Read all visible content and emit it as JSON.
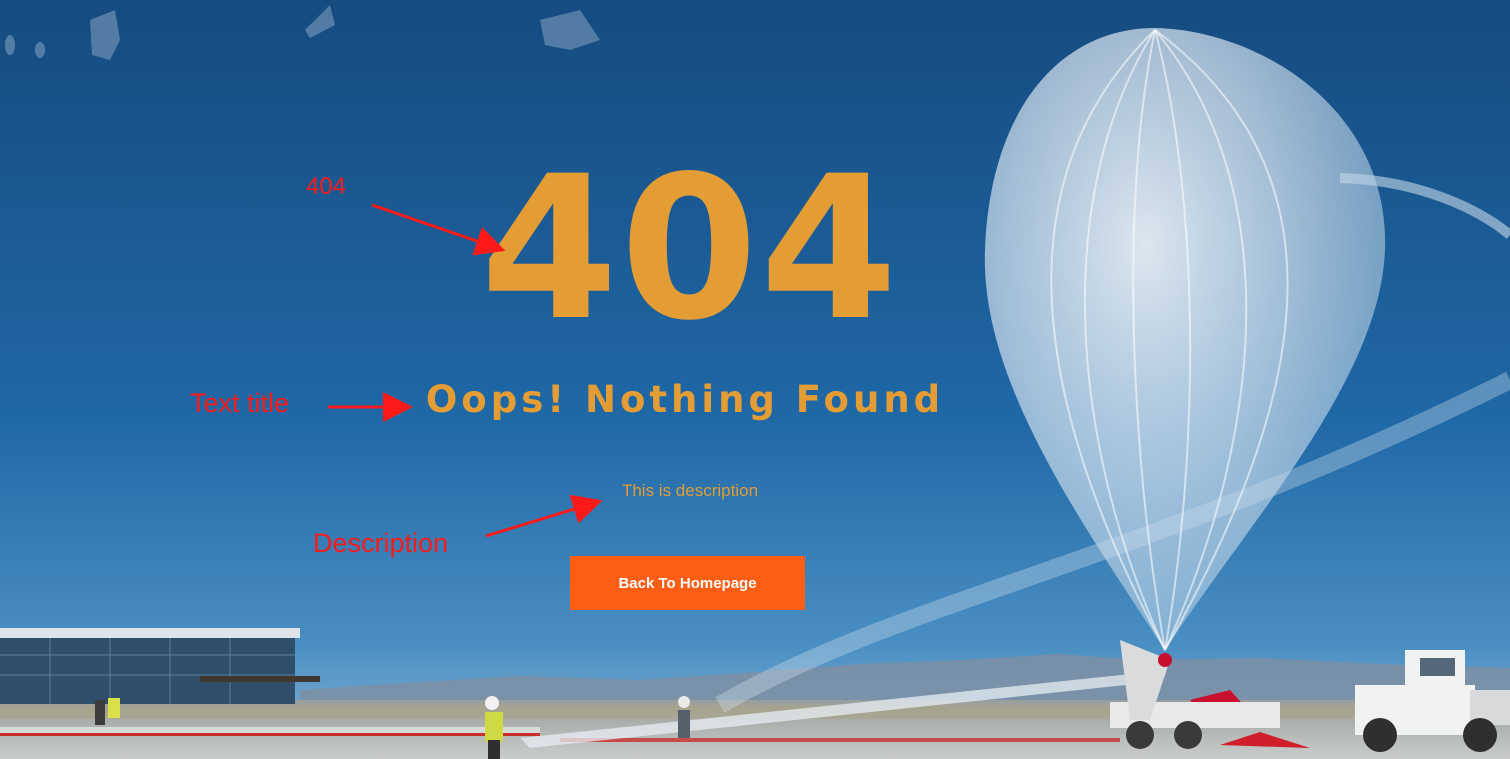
{
  "page": {
    "error_code": "404",
    "title": "Oops! Nothing Found",
    "description": "This is description",
    "button_label": "Back To Homepage"
  },
  "annotations": {
    "code_label": "404",
    "title_label": "Text title",
    "description_label": "Description"
  },
  "colors": {
    "accent_text": "#E39D34",
    "button_bg": "#FD5E14",
    "annotation": "#FF1A1A",
    "sky_top": "#154F86",
    "sky_bottom": "#3D86BD"
  }
}
